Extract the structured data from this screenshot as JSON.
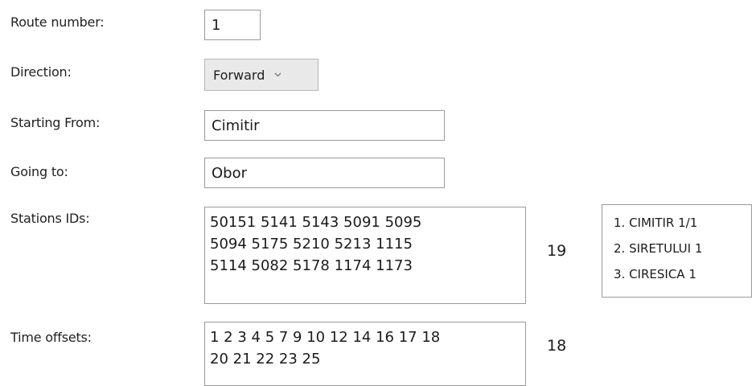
{
  "form": {
    "route_number": {
      "label": "Route number:",
      "value": "1"
    },
    "direction": {
      "label": "Direction:",
      "value": "Forward"
    },
    "starting_from": {
      "label": "Starting From:",
      "value": "Cimitir"
    },
    "going_to": {
      "label": "Going to:",
      "value": "Obor"
    },
    "stations": {
      "label": "Stations IDs:",
      "lines": [
        "50151 5141 5143 5091 5095",
        "5094 5175 5210 5213 1115",
        "5114 5082 5178 1174 1173"
      ],
      "count": "19",
      "list": [
        "1. CIMITIR 1/1",
        "2. SIRETULUI 1",
        "3. CIRESICA 1"
      ]
    },
    "time_offsets": {
      "label": "Time offsets:",
      "lines": [
        "1 2 3 4 5 7 9 10 12 14 16 17 18",
        "20 21 22 23 25"
      ],
      "count": "18"
    }
  },
  "icons": {
    "dropdown": "chevron-down-icon"
  }
}
